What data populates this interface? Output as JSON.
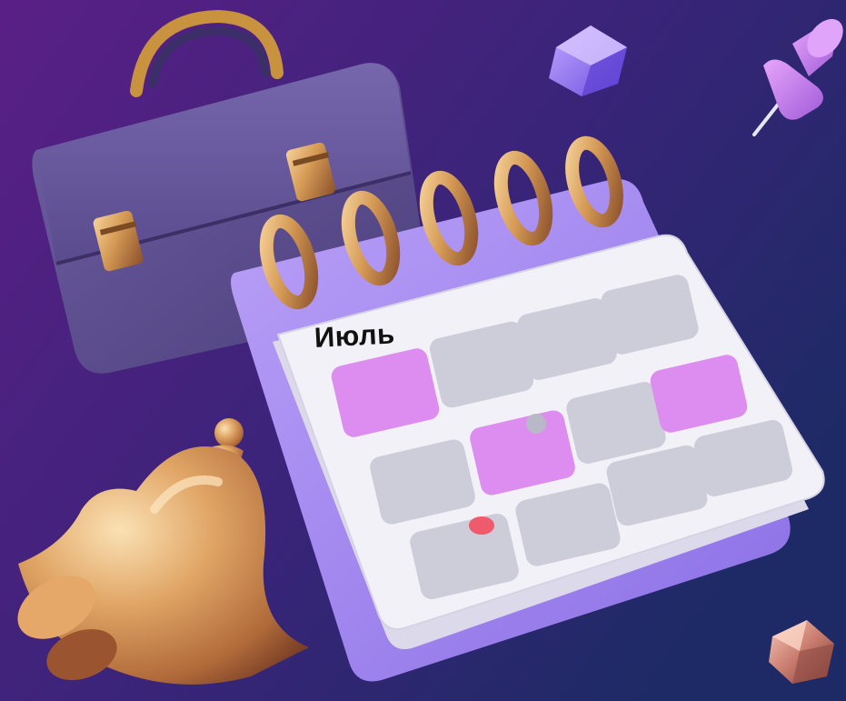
{
  "calendar": {
    "month": "Июль"
  },
  "colors": {
    "background_start": "#5a1f86",
    "background_end": "#1e2a66",
    "briefcase": "#5d4f8c",
    "calendar_page": "#ecebf5",
    "calendar_base": "#a88cf0",
    "highlight_cell": "#dd8cef",
    "empty_cell": "#cdccd9",
    "gold": "#d9a25a",
    "event_dot": "#ef5b6c",
    "pushpin": "#c27bf0",
    "cube": "#9b7bf5"
  },
  "icons": [
    "briefcase-icon",
    "calendar-icon",
    "bell-icon",
    "pushpin-icon",
    "cube-icon",
    "gem-icon"
  ]
}
